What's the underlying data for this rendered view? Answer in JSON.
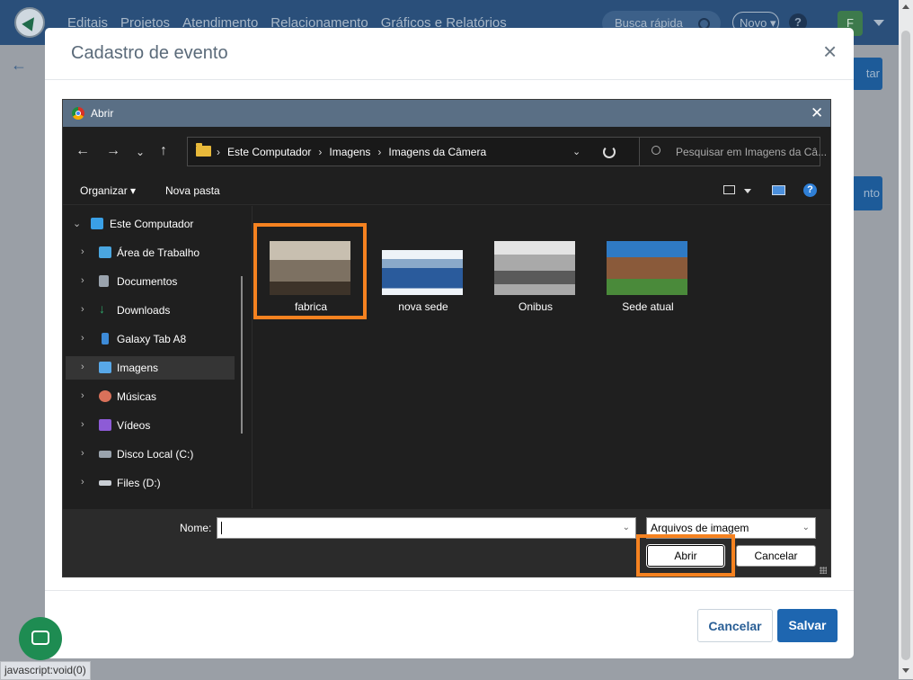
{
  "app": {
    "nav": [
      "Editais",
      "Projetos",
      "Atendimento",
      "Relacionamento",
      "Gráficos e Relatórios"
    ],
    "search_placeholder": "Busca rápida",
    "novo_label": "Novo",
    "help_label": "?",
    "avatar_initial": "F",
    "right_btn1_partial": "tar",
    "right_btn2_partial": "nto"
  },
  "modal": {
    "title": "Cadastro de evento",
    "close_label": "×",
    "cancel_label": "Cancelar",
    "save_label": "Salvar"
  },
  "status_bar": {
    "url": "javascript:void(0)"
  },
  "dialog": {
    "title": "Abrir",
    "close_label": "✕",
    "breadcrumb": [
      "Este Computador",
      "Imagens",
      "Imagens da Câmera"
    ],
    "search_placeholder": "Pesquisar em Imagens da Câ...",
    "toolbar": {
      "organize_label": "Organizar ▾",
      "new_folder_label": "Nova pasta",
      "help_label": "?"
    },
    "nav_tree": [
      {
        "label": "Este Computador",
        "icon": "computer-icon",
        "color": "#3aa0e6",
        "expanded": true
      },
      {
        "label": "Área de Trabalho",
        "icon": "desktop-icon",
        "color": "#4aa6e0"
      },
      {
        "label": "Documentos",
        "icon": "documents-icon",
        "color": "#9aa3ad"
      },
      {
        "label": "Downloads",
        "icon": "downloads-icon",
        "color": "#2fa56a"
      },
      {
        "label": "Galaxy Tab A8",
        "icon": "tablet-icon",
        "color": "#3d8bd8"
      },
      {
        "label": "Imagens",
        "icon": "pictures-icon",
        "color": "#58a8e8",
        "selected": true
      },
      {
        "label": "Músicas",
        "icon": "music-icon",
        "color": "#d9715a"
      },
      {
        "label": "Vídeos",
        "icon": "videos-icon",
        "color": "#8d5bd6"
      },
      {
        "label": "Disco Local (C:)",
        "icon": "drive-c-icon",
        "color": "#9aa3ad"
      },
      {
        "label": "Files (D:)",
        "icon": "drive-d-icon",
        "color": "#c9ced4"
      }
    ],
    "files": [
      {
        "name": "fabrica",
        "thumb_colors": [
          "#7d7162",
          "#c8bfb0",
          "#3d3329"
        ],
        "selected": true
      },
      {
        "name": "nova sede",
        "thumb_colors": [
          "#eef3f8",
          "#2a5b9c",
          "#8aa9c9"
        ]
      },
      {
        "name": "Onibus",
        "thumb_colors": [
          "#e3e3e3",
          "#5a5a5a",
          "#a9a9a9"
        ]
      },
      {
        "name": "Sede atual",
        "thumb_colors": [
          "#2f7ac4",
          "#8a5a3a",
          "#4a8a3a"
        ]
      }
    ],
    "name_label": "Nome:",
    "name_value": "",
    "file_type": "Arquivos de imagem",
    "open_label": "Abrir",
    "cancel_label": "Cancelar"
  }
}
